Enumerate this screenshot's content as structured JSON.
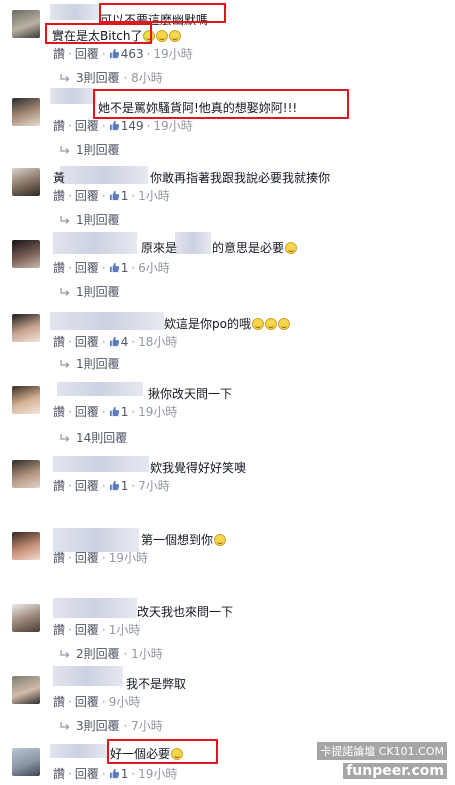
{
  "labels": {
    "like": "讚",
    "reply": "回覆"
  },
  "colors": {
    "highlight_box": "#e0161c",
    "link_gray": "#4e5665",
    "time_gray": "#9197a3"
  },
  "watermark": {
    "line1": "卡提諾論壇 CK101.COM",
    "line2": "funpeer.com"
  },
  "comments": [
    {
      "text_line1": "可以不要這麼幽默嗎",
      "text_line2": "實在是太Bitch了",
      "emoji_count": 3,
      "likes": "463",
      "time": "19小時",
      "replies": "3則回覆",
      "reply_time": "8小時"
    },
    {
      "text_line1": "她不是罵妳騷貨阿!他真的想娶妳阿!!!",
      "likes": "149",
      "time": "19小時",
      "replies": "1則回覆",
      "reply_time": ""
    },
    {
      "text_line1": "你敢再指著我跟我說必要我就揍你",
      "name_prefix": "黃",
      "likes": "1",
      "time": "1小時",
      "replies": "1則回覆",
      "reply_time": ""
    },
    {
      "text_line1": "原來是",
      "text_line1b": "的意思是必要",
      "emoji_count": 1,
      "likes": "1",
      "time": "6小時",
      "replies": "1則回覆",
      "reply_time": ""
    },
    {
      "text_line1": "欸這是你po的哦",
      "emoji_count": 3,
      "likes": "4",
      "time": "18小時",
      "replies": "1則回覆",
      "reply_time": ""
    },
    {
      "text_line1": "揪你改天問一下",
      "likes": "1",
      "time": "19小時",
      "replies": "14則回覆",
      "reply_time": ""
    },
    {
      "text_line1": "欸我覺得好好笑噢",
      "likes": "1",
      "time": "7小時",
      "replies": "",
      "reply_time": ""
    },
    {
      "text_line1": "第一個想到你",
      "emoji_count": 1,
      "likes": "",
      "time": "19小時",
      "replies": "",
      "reply_time": ""
    },
    {
      "text_line1": "改天我也來問一下",
      "likes": "",
      "time": "1小時",
      "replies": "2則回覆",
      "reply_time": "1小時"
    },
    {
      "text_line1": "我不是弊取",
      "likes": "",
      "time": "9小時",
      "replies": "3則回覆",
      "reply_time": "7小時"
    },
    {
      "text_line1": "好一個必要",
      "emoji_count": 1,
      "likes": "1",
      "time": "19小時",
      "replies": "",
      "reply_time": ""
    }
  ]
}
